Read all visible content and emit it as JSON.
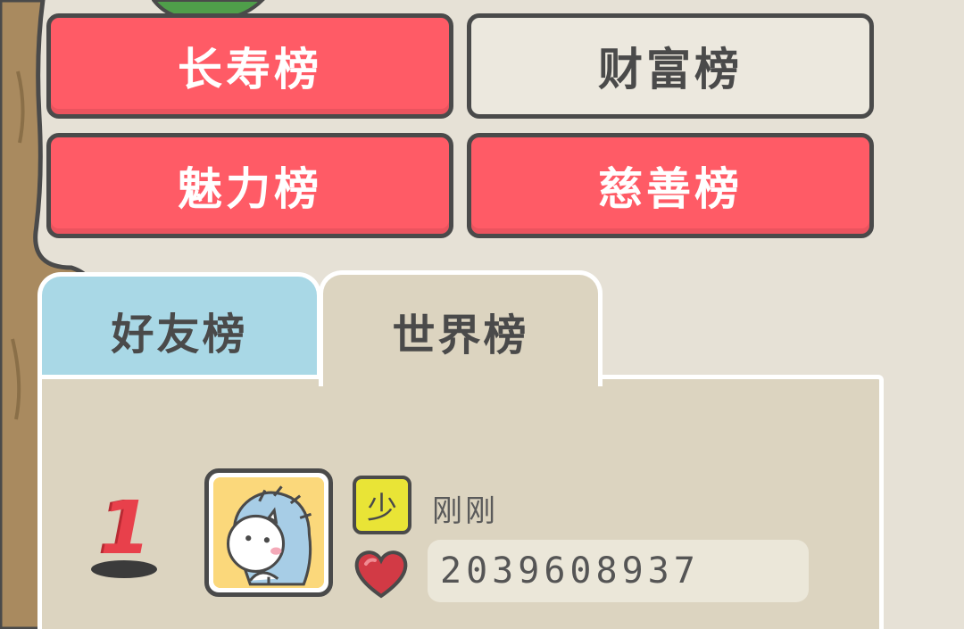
{
  "categories": {
    "longevity": "长寿榜",
    "wealth": "财富榜",
    "charm": "魅力榜",
    "charity": "慈善榜"
  },
  "tabs": {
    "friends": "好友榜",
    "world": "世界榜"
  },
  "leaderboard": [
    {
      "rank": "1",
      "age_badge": "少",
      "name": "刚刚",
      "score": "2039608937"
    }
  ],
  "colors": {
    "active_category": "#ff5b66",
    "inactive_category": "#ece8de",
    "friends_tab": "#a9d8e6",
    "panel": "#dcd4c0",
    "rank": "#e8404b",
    "badge": "#e9e436"
  },
  "icons": {
    "avatar": "hedgehog-avatar-icon",
    "heart": "heart-icon"
  }
}
